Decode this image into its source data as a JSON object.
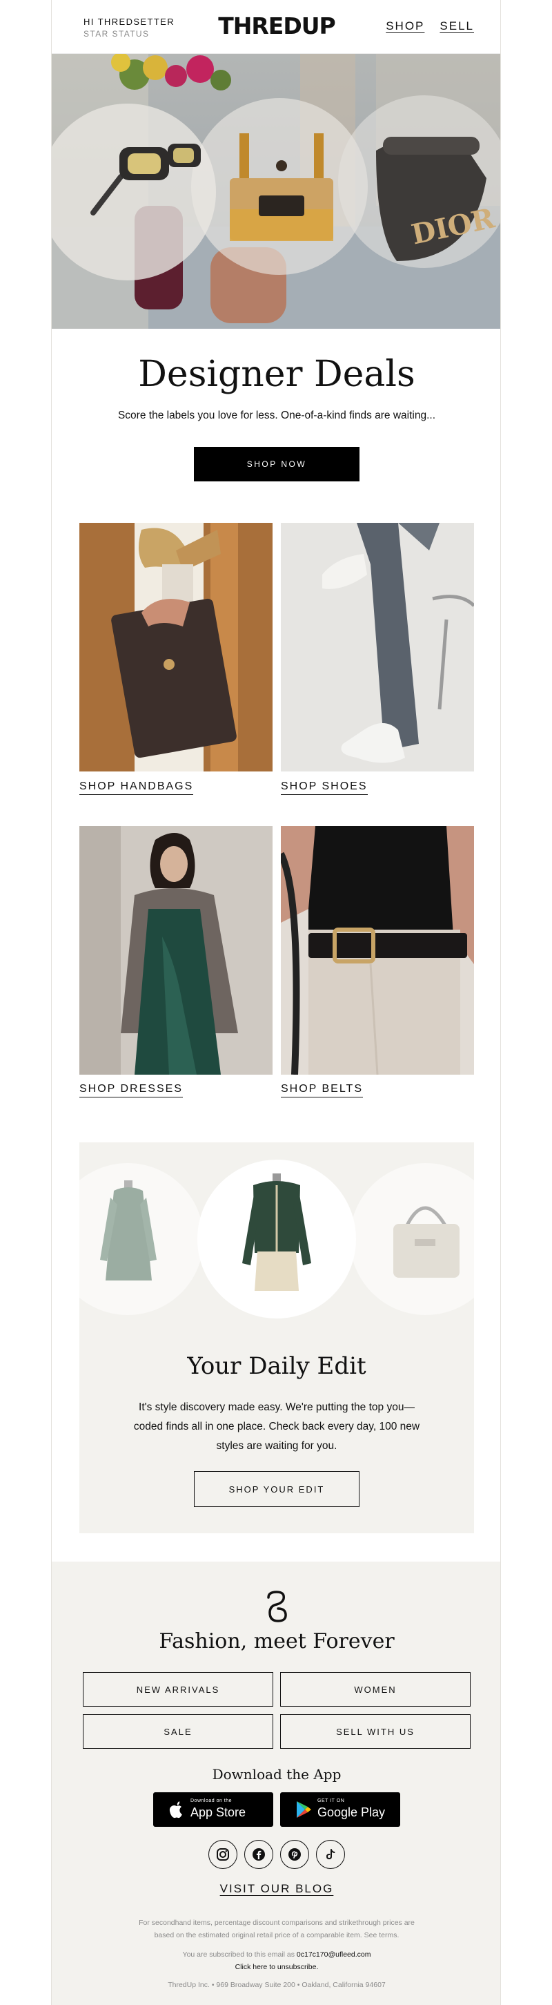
{
  "header": {
    "greeting": "HI THREDSETTER",
    "status": "STAR STATUS",
    "logo": "THREDUP",
    "nav": [
      "SHOP",
      "SELL"
    ]
  },
  "hero": {
    "alt": "Designer sunglasses, handbag and Dior bag on display",
    "brand_text": "DIOR"
  },
  "deals": {
    "title": "Designer Deals",
    "subtitle": "Score the labels you love for less. One-of-a-kind finds are waiting...",
    "cta": "SHOP NOW"
  },
  "categories": [
    {
      "label": "SHOP HANDBAGS"
    },
    {
      "label": "SHOP SHOES"
    },
    {
      "label": "SHOP DRESSES"
    },
    {
      "label": "SHOP BELTS"
    }
  ],
  "daily_edit": {
    "title": "Your Daily Edit",
    "text": "It's style discovery made easy. We're putting the top you—coded finds all in one place. Check back every day, 100 new styles are waiting for you.",
    "cta": "SHOP YOUR EDIT"
  },
  "footer": {
    "title": "Fashion, meet Forever",
    "buttons": [
      "NEW ARRIVALS",
      "WOMEN",
      "SALE",
      "SELL WITH US"
    ],
    "app_heading": "Download the App",
    "app_store": {
      "small": "Download on the",
      "big": "App Store"
    },
    "google_play": {
      "small": "GET IT ON",
      "big": "Google Play"
    },
    "socials": [
      "instagram",
      "facebook",
      "pinterest",
      "tiktok"
    ],
    "blog": "VISIT OUR BLOG",
    "disclaimer_1": "For secondhand items, percentage discount comparisons and strikethrough prices are",
    "disclaimer_2": "based on the estimated original retail price of a comparable item.",
    "see_terms": "See terms.",
    "subscribed_prefix": "You are subscribed to this email as",
    "email": "0c17c170@ufleed.com",
    "unsubscribe": "Click here to unsubscribe.",
    "address": "ThredUp Inc. • 969 Broadway Suite 200 • Oakland, California 94607"
  },
  "colors": {
    "background": "#ffffff",
    "panel": "#f3f2ee",
    "ink": "#111111",
    "muted": "#8a8a8a"
  }
}
